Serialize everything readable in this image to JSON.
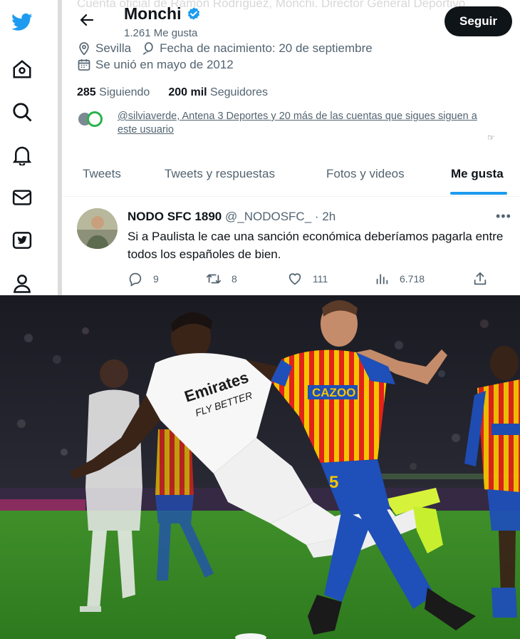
{
  "profile": {
    "faded_bio": "Cuenta oficial de Ramón Rodríguez, Monchi. Director General Deportivo",
    "name": "Monchi",
    "likes": "1.261 Me gusta",
    "follow_label": "Seguir",
    "location": "Sevilla",
    "birthday": "Fecha de nacimiento: 20 de septiembre",
    "joined": "Se unió en mayo de 2012",
    "following_count": "285",
    "following_label": "Siguiendo",
    "followers_count": "200 mil",
    "followers_label": "Seguidores",
    "followed_by_line1": "@silviaverde, Antena 3 Deportes y 20 más de las cuentas que sigues siguen a",
    "followed_by_line2": "este usuario"
  },
  "tabs": [
    {
      "label": "Tweets"
    },
    {
      "label": "Tweets y respuestas"
    },
    {
      "label": "Fotos y videos"
    },
    {
      "label": "Me gusta"
    }
  ],
  "tweet": {
    "author_name": "NODO SFC 1890",
    "handle": "@_NODOSFC_",
    "time": "· 2h",
    "text": "Si a Paulista le cae una sanción económica deberíamos pagarla entre todos los españoles de bien.",
    "replies": "9",
    "retweets": "8",
    "likes": "111",
    "views": "6.718"
  },
  "photo": {
    "jersey_text": "Emirates",
    "jersey_sub": "FLY BETTER",
    "sponsor": "CAZOO",
    "shirt_number": "5"
  },
  "colors": {
    "accent": "#1d9bf0",
    "text_primary": "#0f1419",
    "text_secondary": "#536471",
    "pitch": "#4a9a2e"
  },
  "icons": [
    "twitter-logo-icon",
    "home-icon",
    "search-icon",
    "bell-icon",
    "mail-icon",
    "bookmark-icon",
    "profile-icon",
    "back-arrow-icon",
    "verified-icon",
    "location-icon",
    "balloon-icon",
    "calendar-icon",
    "reply-icon",
    "retweet-icon",
    "heart-icon",
    "views-icon",
    "share-icon",
    "more-icon"
  ]
}
